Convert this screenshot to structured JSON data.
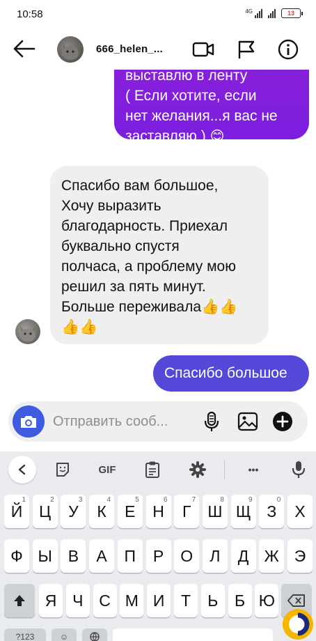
{
  "status_bar": {
    "time": "10:58",
    "network": "4G",
    "battery": "13"
  },
  "header": {
    "username": "666_helen_..."
  },
  "messages": {
    "outgoing_1": {
      "lines": [
        "выставлю в ленту",
        "( Если хотите, если",
        "нет желания...я вас не",
        "заставляю )"
      ],
      "emoji": "😊"
    },
    "incoming": {
      "lines": [
        "Спасибо вам большое,",
        "Хочу выразить",
        "благодарность. Приехал",
        "буквально спустя",
        "полчаса, а проблему мою",
        "решил за пять минут.",
        "Больше переживала👍👍",
        "👍👍"
      ]
    },
    "outgoing_2": {
      "text": "Спасибо большое"
    }
  },
  "composer": {
    "placeholder": "Отправить сооб..."
  },
  "keyboard": {
    "toolbar": {
      "gif": "GIF",
      "more": "•••"
    },
    "row1": [
      [
        "Й",
        "1"
      ],
      [
        "Ц",
        "2"
      ],
      [
        "У",
        "3"
      ],
      [
        "К",
        "4"
      ],
      [
        "Е",
        "5"
      ],
      [
        "Н",
        "6"
      ],
      [
        "Г",
        "7"
      ],
      [
        "Ш",
        "8"
      ],
      [
        "Щ",
        "9"
      ],
      [
        "З",
        "0"
      ],
      [
        "Х",
        ""
      ]
    ],
    "row2": [
      "Ф",
      "Ы",
      "В",
      "А",
      "П",
      "Р",
      "О",
      "Л",
      "Д",
      "Ж",
      "Э"
    ],
    "row3": [
      "Я",
      "Ч",
      "С",
      "М",
      "И",
      "Т",
      "Ь",
      "Б",
      "Ю"
    ],
    "row4_partial": [
      "?123",
      "☺"
    ]
  },
  "colors": {
    "outgoing_purple": "#7c1ee0",
    "outgoing_blue": "#5548d8",
    "camera_blue": "#3f5be0",
    "incoming_gray": "#efefef",
    "keyboard_bg": "#e9ebef"
  }
}
